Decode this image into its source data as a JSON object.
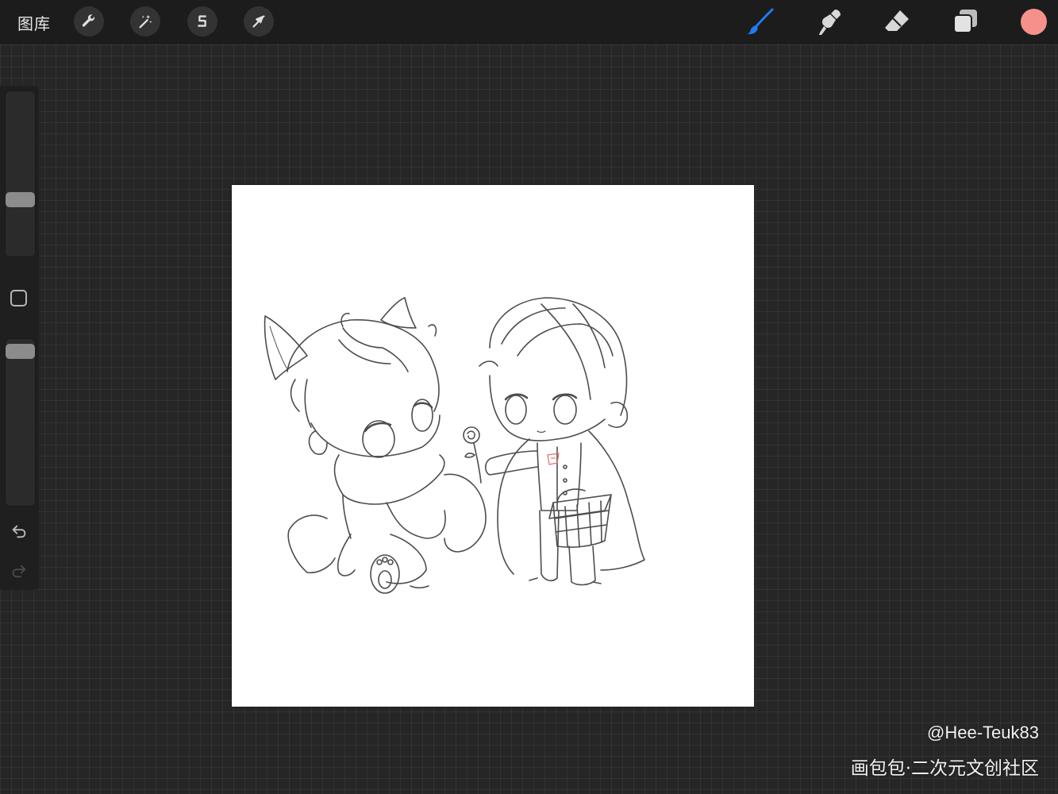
{
  "toolbar": {
    "gallery_label": "图库",
    "left_tools": [
      {
        "name": "actions",
        "icon": "wrench-icon"
      },
      {
        "name": "adjustments",
        "icon": "magic-wand-icon"
      },
      {
        "name": "selection",
        "icon": "selection-s-icon"
      },
      {
        "name": "transform",
        "icon": "arrow-cursor-icon"
      }
    ],
    "right_tools": [
      {
        "name": "brush",
        "icon": "brush-icon",
        "active": true
      },
      {
        "name": "smudge",
        "icon": "smudge-icon",
        "active": false
      },
      {
        "name": "eraser",
        "icon": "eraser-icon",
        "active": false
      },
      {
        "name": "layers",
        "icon": "layers-icon",
        "active": false
      }
    ],
    "current_color": "#f5918a",
    "active_tool_color": "#1e7cf2"
  },
  "sidebar": {
    "brush_size_level": 0.33,
    "opacity_level": 0.97
  },
  "watermark": {
    "handle": "@Hee-Teuk83",
    "site": "画包包·二次元文创社区"
  }
}
